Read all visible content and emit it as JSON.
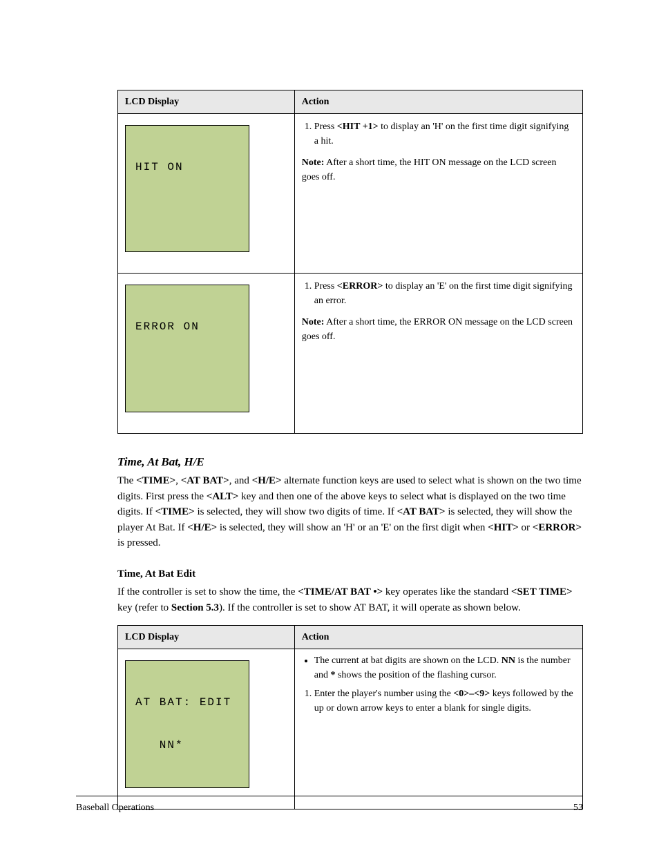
{
  "tables": {
    "t1": {
      "headers": {
        "lcd": "LCD Display",
        "action": "Action"
      },
      "rows": [
        {
          "lcd": {
            "line1": "HIT ON",
            "line2": " "
          },
          "action": {
            "steps": [
              {
                "prefix": "Press ",
                "key": "<HIT +1>",
                "rest": " to display an 'H' on the first time digit signifying a hit."
              }
            ],
            "after": "After a short time, the HIT ON message on the LCD screen goes off."
          }
        },
        {
          "lcd": {
            "line1": "ERROR ON",
            "line2": " "
          },
          "action": {
            "steps": [
              {
                "prefix": "Press ",
                "key": "<ERROR>",
                "rest": " to display an 'E' on the first time digit signifying an error."
              }
            ],
            "after": "After a short time, the ERROR ON message on the LCD screen goes off."
          }
        }
      ]
    },
    "t2": {
      "headers": {
        "lcd": "LCD Display",
        "action": "Action"
      },
      "rows": [
        {
          "lcd": {
            "line1": "AT BAT: EDIT",
            "line2": "   NN*"
          },
          "action": {
            "bullets": [
              {
                "text_a": "The current at bat digits are shown on the LCD. ",
                "key_b": "NN",
                "text_c": " is the number and ",
                "key_d": "*",
                "text_e": " shows the position of the flashing cursor."
              }
            ],
            "steps": [
              {
                "prefix": "Enter the player's number using the ",
                "key": "<0>–<9>",
                "rest": " keys followed by the up or down arrow keys to enter a blank for single digits."
              }
            ]
          }
        }
      ]
    }
  },
  "section": {
    "title": "Time, At Bat, H/E",
    "para_parts": [
      "The ",
      {
        "k": "<TIME>"
      },
      ", ",
      {
        "k": "<AT BAT>"
      },
      ", and ",
      {
        "k": "<H/E>"
      },
      " alternate function keys are used to select what is shown on the two time digits. First press the ",
      {
        "k": "<ALT>"
      },
      " key and then one of the above keys to select what is displayed on the two time digits. If ",
      {
        "k": "<TIME>"
      },
      " is selected, they will show two digits of time. If ",
      {
        "k": "<AT BAT>"
      },
      " is selected, they will show the player At Bat. If ",
      {
        "k": "<H/E>"
      },
      " is selected, they will show an 'H' or an 'E' on the first digit when ",
      {
        "k": "<HIT>"
      },
      " or ",
      {
        "k": "<ERROR>"
      },
      " is pressed."
    ]
  },
  "subsection": {
    "title": "Time, At Bat Edit",
    "para_parts": [
      "If the controller is set to show the time, the ",
      {
        "k": "<TIME/AT BAT •>"
      },
      " key operates like the standard ",
      {
        "k": "<SET TIME>"
      },
      " key (refer to ",
      {
        "b": "Section 5.3"
      },
      "). If the controller is set to show AT BAT, it will operate as shown below."
    ]
  },
  "footer": {
    "left": "Baseball Operations",
    "right": "53"
  },
  "note_label": "Note:"
}
